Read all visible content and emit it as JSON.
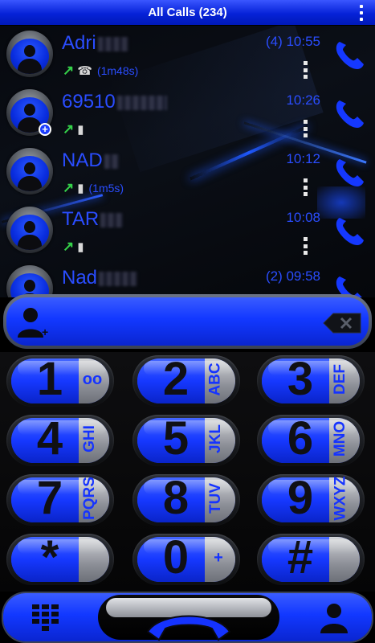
{
  "header": {
    "title": "All Calls (234)"
  },
  "calls": [
    {
      "name": "Adri",
      "time": "(4) 10:55",
      "direction": "outgoing",
      "device": "landline",
      "duration": "(1m48s)",
      "badge": false
    },
    {
      "name": "69510",
      "time": "10:26",
      "direction": "outgoing",
      "device": "mobile",
      "duration": "",
      "badge": true
    },
    {
      "name": "NAD",
      "time": "10:12",
      "direction": "outgoing",
      "device": "mobile",
      "duration": "(1m5s)",
      "badge": false
    },
    {
      "name": "TAR",
      "time": "10:08",
      "direction": "outgoing",
      "device": "mobile",
      "duration": "",
      "badge": false
    },
    {
      "name": "Nad",
      "time": "(2) 09:58",
      "direction": "outgoing",
      "device": "mobile",
      "duration": "",
      "badge": false
    }
  ],
  "icons": {
    "outgoing_arrow": "↗",
    "landline": "☎",
    "mobile": "▮",
    "badge_plus": "+"
  },
  "keypad": {
    "keys": [
      {
        "digit": "1",
        "letters": "",
        "symbol": "oo"
      },
      {
        "digit": "2",
        "letters": "ABC",
        "symbol": ""
      },
      {
        "digit": "3",
        "letters": "DEF",
        "symbol": ""
      },
      {
        "digit": "4",
        "letters": "GHI",
        "symbol": ""
      },
      {
        "digit": "5",
        "letters": "JKL",
        "symbol": ""
      },
      {
        "digit": "6",
        "letters": "MNO",
        "symbol": ""
      },
      {
        "digit": "7",
        "letters": "PQRS",
        "symbol": ""
      },
      {
        "digit": "8",
        "letters": "TUV",
        "symbol": ""
      },
      {
        "digit": "9",
        "letters": "WXYZ",
        "symbol": ""
      },
      {
        "digit": "*",
        "letters": "",
        "symbol": ""
      },
      {
        "digit": "0",
        "letters": "",
        "symbol": "+"
      },
      {
        "digit": "#",
        "letters": "",
        "symbol": ""
      }
    ]
  },
  "colors": {
    "accent": "#1533ff",
    "call_arrow": "#35d24a",
    "background": "#000000"
  }
}
